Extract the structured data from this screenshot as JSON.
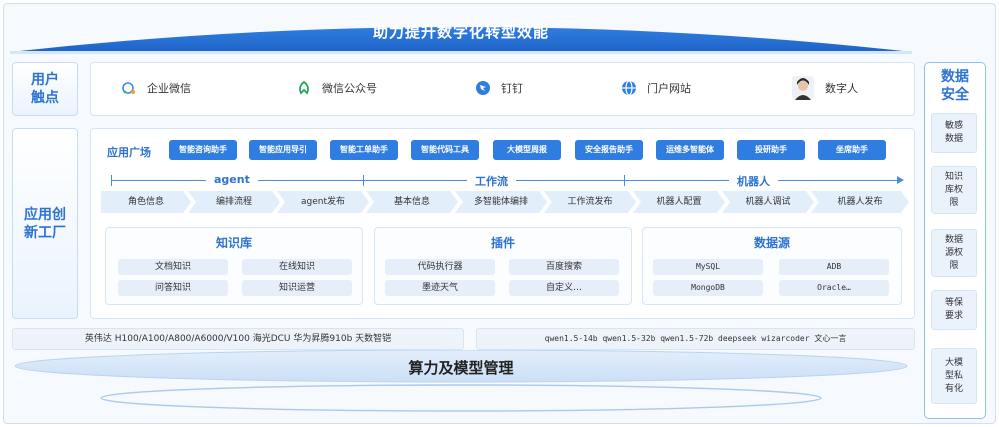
{
  "banner": {
    "title": "助力提升数字化转型效能"
  },
  "touch_points": {
    "label": "用户\n触点",
    "items": [
      {
        "label": "企业微信",
        "icon": "wecom-icon"
      },
      {
        "label": "微信公众号",
        "icon": "wechat-official-icon"
      },
      {
        "label": "钉钉",
        "icon": "dingtalk-icon"
      },
      {
        "label": "门户网站",
        "icon": "globe-icon"
      },
      {
        "label": "数字人",
        "icon": "digital-human-avatar"
      }
    ]
  },
  "app_factory": {
    "label": "应用创\n新工厂",
    "plaza_label": "应用广场",
    "plaza_items": [
      "智能咨询助手",
      "智能应用导引",
      "智能工单助手",
      "智能代码工具",
      "大模型周报",
      "安全报告助手",
      "运维多智能体",
      "投研助手",
      "坐席助手"
    ],
    "stages": [
      "agent",
      "工作流",
      "机器人"
    ],
    "steps": [
      "角色信息",
      "编排流程",
      "agent发布",
      "基本信息",
      "多智能体编排",
      "工作流发布",
      "机器人配置",
      "机器人调试",
      "机器人发布"
    ],
    "panels": [
      {
        "title": "知识库",
        "items": [
          "文档知识",
          "在线知识",
          "问答知识",
          "知识运营"
        ]
      },
      {
        "title": "插件",
        "items": [
          "代码执行器",
          "百度搜索",
          "墨迹天气",
          "自定义…"
        ]
      },
      {
        "title": "数据源",
        "items": [
          "MySQL",
          "ADB",
          "MongoDB",
          "Oracle…"
        ]
      }
    ]
  },
  "compute": {
    "hardware": "英伟达 H100/A100/A800/A6000/V100   海光DCU   华为昇腾910b   天数智铠",
    "models": "qwen1.5-14b  qwen1.5-32b  qwen1.5-72b  deepseek  wizarcoder  文心一言",
    "title": "算力及模型管理"
  },
  "security": {
    "title": "数据\n安全",
    "items": [
      "敏感\n数据",
      "知识\n库权\n限",
      "数据\n源权\n限",
      "等保\n要求",
      "大模\n型私\n有化"
    ]
  },
  "colors": {
    "primary": "#2f7de1",
    "accent_text": "#2e73d2",
    "pill_bg": "#e6eefa"
  }
}
